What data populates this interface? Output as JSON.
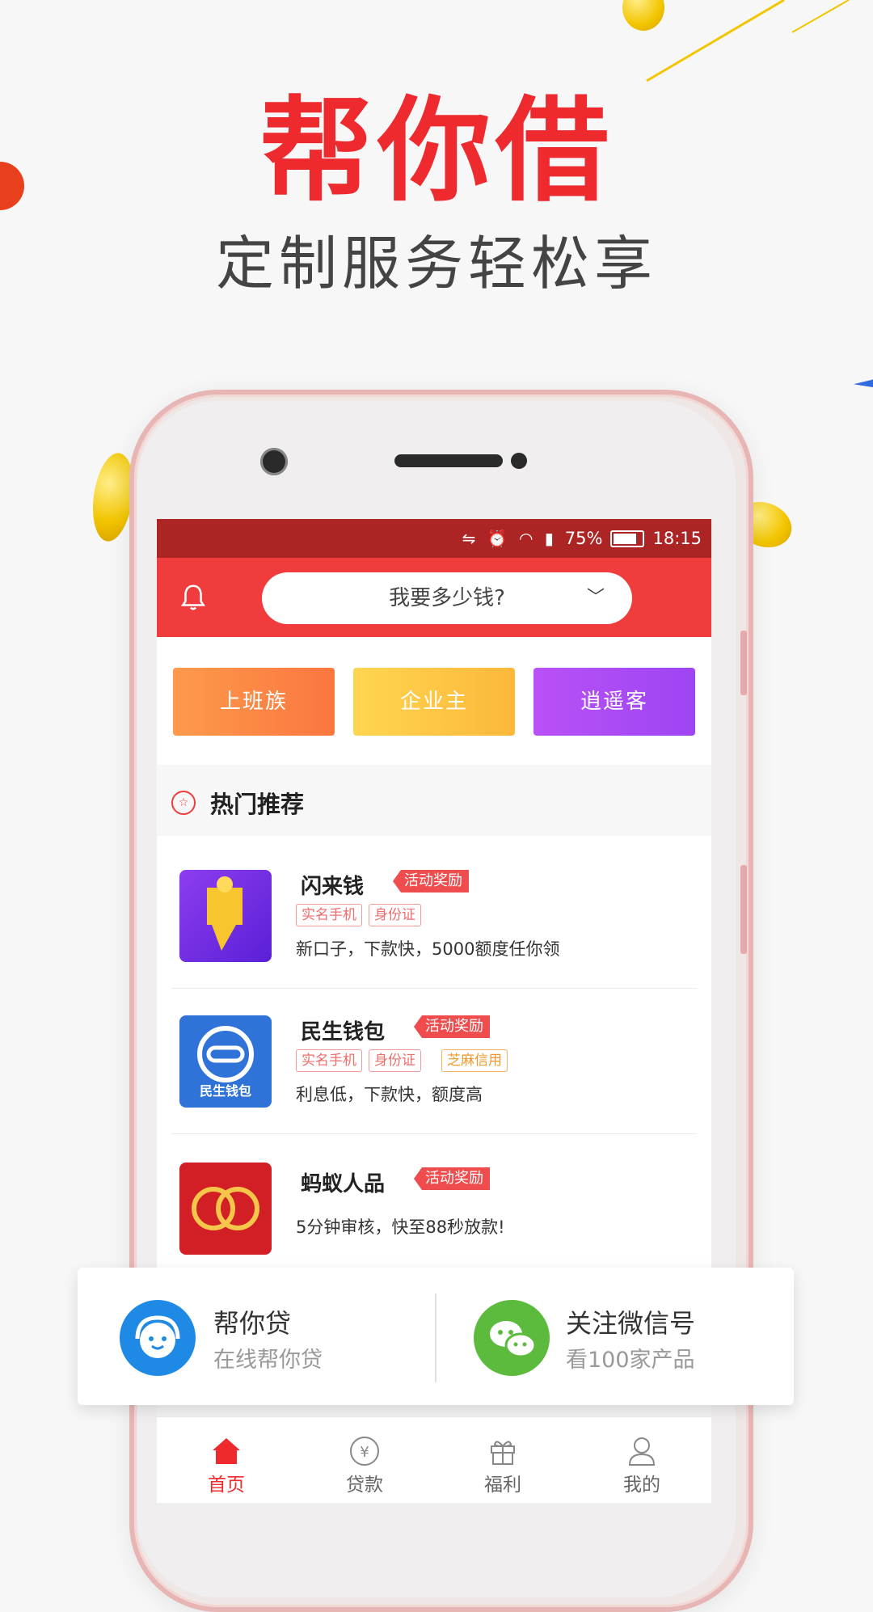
{
  "promo": {
    "title": "帮你借",
    "subtitle": "定制服务轻松享"
  },
  "status_bar": {
    "battery": "75%",
    "time": "18:15"
  },
  "header": {
    "search_text": "我要多少钱?"
  },
  "categories": [
    {
      "label": "上班族"
    },
    {
      "label": "企业主"
    },
    {
      "label": "逍遥客"
    }
  ],
  "hot_section": {
    "title": "热门推荐"
  },
  "products": [
    {
      "name": "闪来钱",
      "badge": "活动奖励",
      "tags": [
        "实名手机",
        "身份证"
      ],
      "desc": "新口子，下款快，5000额度任你领"
    },
    {
      "name": "民生钱包",
      "badge": "活动奖励",
      "tags": [
        "实名手机",
        "身份证",
        "芝麻信用"
      ],
      "desc": "利息低，下款快，额度高",
      "logo_text": "民生钱包"
    },
    {
      "name": "蚂蚁人品",
      "badge": "活动奖励",
      "tags": [],
      "desc": "5分钟审核，快至88秒放款!"
    }
  ],
  "float_card": {
    "left_title": "帮你贷",
    "left_sub": "在线帮你贷",
    "right_title": "关注微信号",
    "right_sub": "看100家产品"
  },
  "bottom_nav": [
    {
      "label": "首页",
      "icon": "home-icon",
      "active": true
    },
    {
      "label": "贷款",
      "icon": "yen-icon",
      "active": false
    },
    {
      "label": "福利",
      "icon": "gift-icon",
      "active": false
    },
    {
      "label": "我的",
      "icon": "user-icon",
      "active": false
    }
  ],
  "colors": {
    "brand_red": "#ee2a2f",
    "status_bar": "#ad2424",
    "top_bar": "#f03c3c"
  }
}
